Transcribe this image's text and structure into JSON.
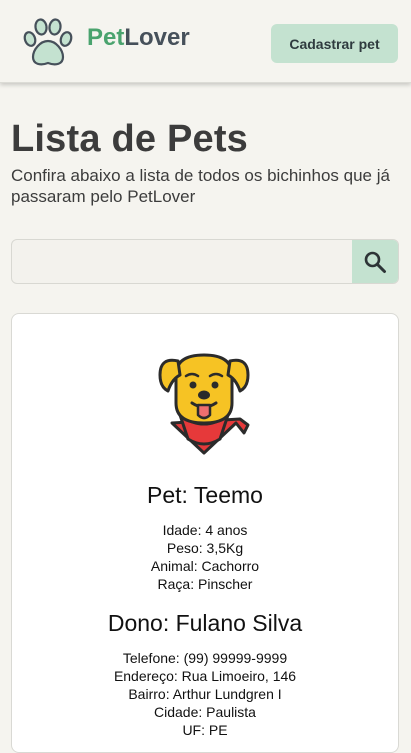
{
  "header": {
    "brand_pet": "Pet",
    "brand_lover": "Lover",
    "register_button": "Cadastrar pet",
    "logo_icon": "paw-icon"
  },
  "page": {
    "title": "Lista de Pets",
    "subtitle": "Confira abaixo a lista de todos os bichinhos que já passaram pelo PetLover"
  },
  "search": {
    "value": "",
    "placeholder": "",
    "icon": "search-icon"
  },
  "pets": [
    {
      "image_icon": "dog-icon",
      "pet_title": "Pet: Teemo",
      "age": "Idade: 4 anos",
      "weight": "Peso: 3,5Kg",
      "animal": "Animal: Cachorro",
      "breed": "Raça: Pinscher",
      "owner_title": "Dono: Fulano Silva",
      "phone": "Telefone: (99) 99999-9999",
      "address": "Endereço: Rua Limoeiro, 146",
      "district": "Bairro: Arthur Lundgren I",
      "city": "Cidade: Paulista",
      "state": "UF: PE"
    }
  ],
  "colors": {
    "accent": "#c4e2d0",
    "brand_green": "#4aa36e",
    "background": "#f5f4ef"
  }
}
